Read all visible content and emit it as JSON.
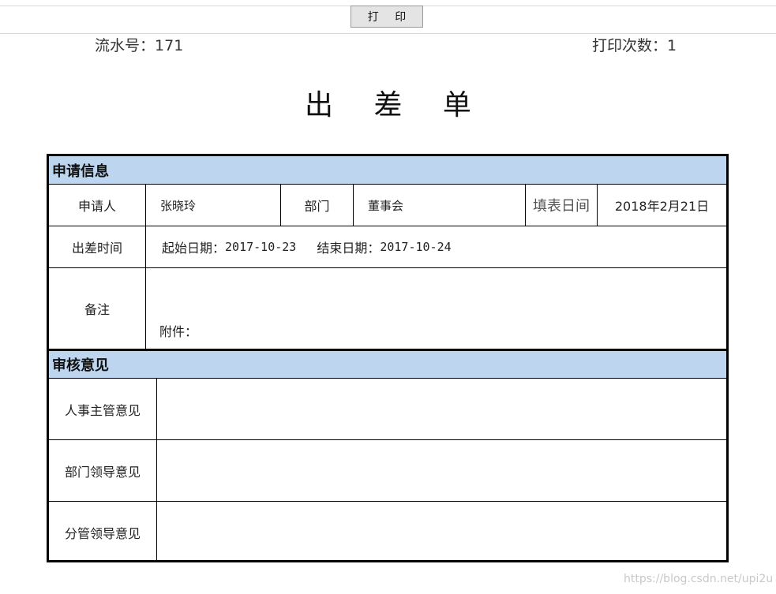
{
  "toolbar": {
    "print_label": "打 印"
  },
  "header": {
    "serial_label": "流水号：",
    "serial_value": "171",
    "print_count_label": "打印次数：",
    "print_count_value": "1"
  },
  "title": "出 差 单",
  "sections": {
    "apply_info": "申请信息",
    "review": "审核意见"
  },
  "apply": {
    "applicant_label": "申请人",
    "applicant_value": "张晓玲",
    "department_label": "部门",
    "department_value": "董事会",
    "fill_date_label": "填表日间",
    "fill_date_value": "2018年2月21日",
    "trip_time_label": "出差时间",
    "start_label": "起始日期：",
    "start_value": "2017-10-23",
    "end_label": "结束日期：",
    "end_value": "2017-10-24",
    "remark_label": "备注",
    "attachment_label": "附件："
  },
  "review": {
    "hr_label": "人事主管意见",
    "dept_label": "部门领导意见",
    "division_label": "分管领导意见"
  },
  "watermark": "https://blog.csdn.net/upi2u"
}
